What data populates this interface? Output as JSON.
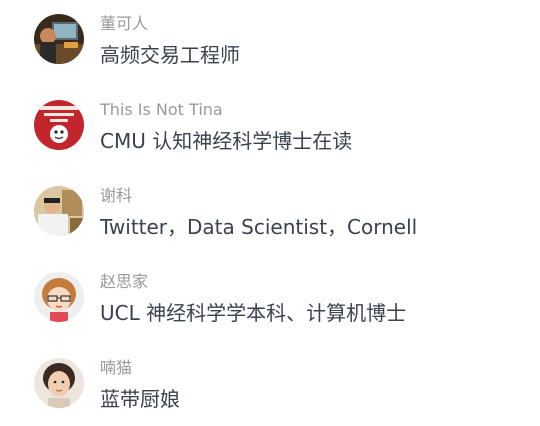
{
  "people": [
    {
      "name": "董可人",
      "description": "高频交易工程师",
      "avatar_icon": "person-at-computer-avatar"
    },
    {
      "name": "This Is Not Tina",
      "description": "CMU 认知神经科学博士在读",
      "avatar_icon": "red-poster-avatar"
    },
    {
      "name": "谢科",
      "description": "Twitter，Data Scientist，Cornell",
      "avatar_icon": "man-portrait-avatar"
    },
    {
      "name": "赵思家",
      "description": "UCL 神经科学学本科、计算机博士",
      "avatar_icon": "cartoon-girl-glasses-avatar"
    },
    {
      "name": "喃猫",
      "description": "蓝带厨娘",
      "avatar_icon": "woman-portrait-avatar"
    }
  ]
}
